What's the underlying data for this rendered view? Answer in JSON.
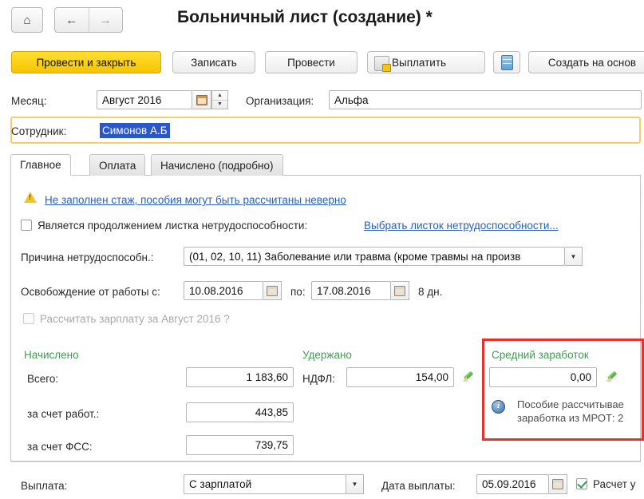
{
  "window": {
    "title": "Больничный лист (создание) *",
    "nav": {
      "home_icon": "home-icon",
      "back_icon": "arrow-left-icon",
      "forward_icon": "arrow-right-icon"
    }
  },
  "toolbar": {
    "post_and_close": "Провести и закрыть",
    "save": "Записать",
    "post": "Провести",
    "pay": "Выплатить",
    "pay_icon": "payment-icon",
    "report_icon": "print-report-icon",
    "create_based_on": "Создать на основ"
  },
  "header": {
    "month_label": "Месяц:",
    "month_value": "Август 2016",
    "calendar_icon": "calendar-icon",
    "spinner_icon": "spinner-updown-icon",
    "organization_label": "Организация:",
    "organization_value": "Альфа",
    "employee_label": "Сотрудник:",
    "employee_value": "Симонов А.Б"
  },
  "tabs": [
    {
      "label": "Главное",
      "active": true
    },
    {
      "label": "Оплата",
      "active": false
    },
    {
      "label": "Начислено (подробно)",
      "active": false
    }
  ],
  "main": {
    "warning_icon": "warning-triangle-icon",
    "warning_link": "Не заполнен стаж, пособия могут быть рассчитаны неверно",
    "continuation_checkbox_label": "Является продолжением листка нетрудоспособности:",
    "continuation_checkbox_checked": false,
    "choose_sheet_link": "Выбрать листок нетрудоспособности...",
    "reason_label": "Причина нетрудоспособн.:",
    "reason_value": "(01, 02, 10, 11) Заболевание или травма (кроме травмы на произв",
    "reason_dropdown_icon": "chevron-down-icon",
    "release_label": "Освобождение от работы с:",
    "release_from": "10.08.2016",
    "release_to_label": "по:",
    "release_to": "17.08.2016",
    "release_days": "8 дн.",
    "calc_salary_checkbox_label": "Рассчитать зарплату за Август 2016 ?",
    "calc_salary_checkbox_checked": false
  },
  "accrued": {
    "section_title": "Начислено",
    "rows": [
      {
        "label": "Всего:",
        "value": "1 183,60"
      },
      {
        "label": "за счет работ.:",
        "value": "443,85"
      },
      {
        "label": "за счет ФСС:",
        "value": "739,75"
      }
    ]
  },
  "withheld": {
    "section_title": "Удержано",
    "ndfl_label": "НДФЛ:",
    "ndfl_value": "154,00",
    "edit_icon": "pencil-edit-icon"
  },
  "average_earnings": {
    "section_title": "Средний заработок",
    "value": "0,00",
    "edit_icon": "pencil-edit-icon",
    "info_icon": "info-icon",
    "info_line1": "Пособие рассчитывае",
    "info_line2": "заработка из МРОТ: 2"
  },
  "footer": {
    "payment_label": "Выплата:",
    "payment_value": "С зарплатой",
    "payment_dropdown_icon": "chevron-down-icon",
    "payment_date_label": "Дата выплаты:",
    "payment_date_value": "05.09.2016",
    "payment_date_calendar_icon": "calendar-icon",
    "recalc_checkbox_label": "Расчет у",
    "recalc_checkbox_checked": true
  },
  "colors": {
    "primary_button": "#f5c400",
    "highlight_border": "#f2d06b",
    "selection": "#2b57c9",
    "section_header": "#3f9b52",
    "link": "#2b5fb8",
    "attention_box": "#e8312a"
  }
}
